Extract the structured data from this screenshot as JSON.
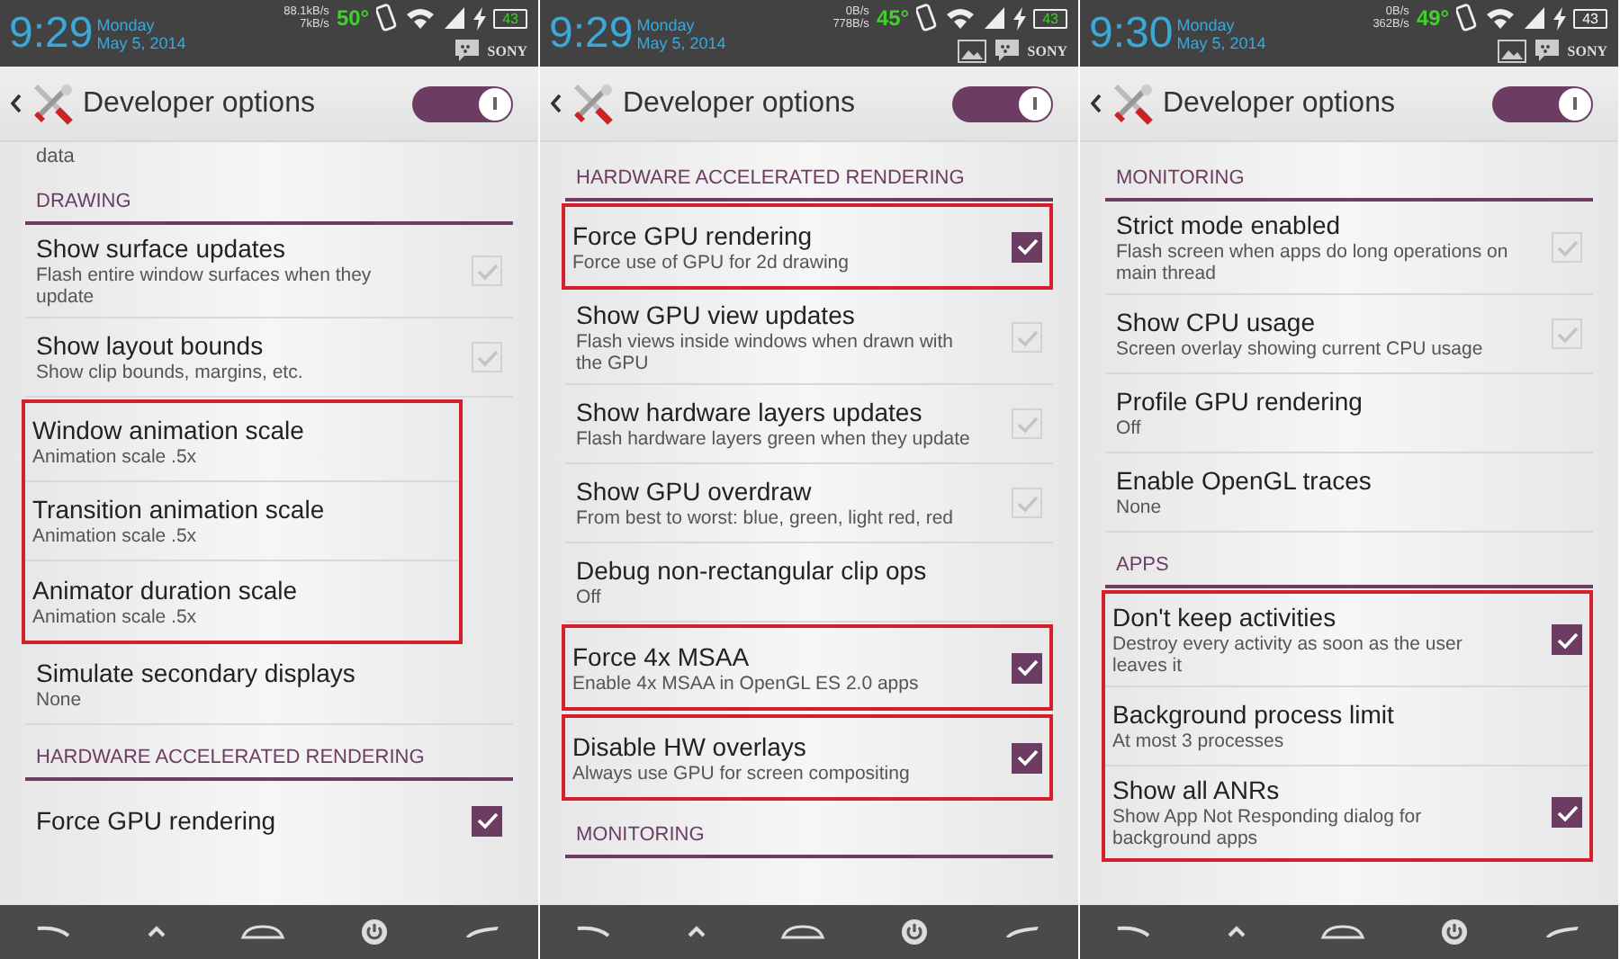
{
  "panels": [
    {
      "status_bar": {
        "time": "9:29",
        "day": "Monday",
        "date": "May 5, 2014",
        "net_up": "88.1kB/s",
        "net_down": "7kB/s",
        "temperature": "50°",
        "battery": "43",
        "battery_green": true,
        "image_notification": false,
        "brand": "SONY"
      },
      "header": {
        "title": "Developer options",
        "switch_on": true
      },
      "items": [
        {
          "kind": "fragment",
          "text": "data"
        },
        {
          "kind": "header",
          "label": "DRAWING"
        },
        {
          "kind": "option",
          "title": "Show surface updates",
          "summary": "Flash entire window surfaces when they update",
          "checked": false
        },
        {
          "kind": "option",
          "title": "Show layout bounds",
          "summary": "Show clip bounds, margins, etc.",
          "checked": false
        },
        {
          "kind": "highlight",
          "narrow": true,
          "items": [
            {
              "kind": "option",
              "title": "Window animation scale",
              "summary": "Animation scale .5x"
            },
            {
              "kind": "option",
              "title": "Transition animation scale",
              "summary": "Animation scale .5x"
            },
            {
              "kind": "option",
              "title": "Animator duration scale",
              "summary": "Animation scale .5x"
            }
          ]
        },
        {
          "kind": "option",
          "title": "Simulate secondary displays",
          "summary": "None"
        },
        {
          "kind": "header",
          "label": "HARDWARE ACCELERATED RENDERING"
        },
        {
          "kind": "option",
          "title": "Force GPU rendering",
          "checked": true
        }
      ]
    },
    {
      "status_bar": {
        "time": "9:29",
        "day": "Monday",
        "date": "May 5, 2014",
        "net_up": "0B/s",
        "net_down": "778B/s",
        "temperature": "45°",
        "battery": "43",
        "battery_green": true,
        "image_notification": true,
        "brand": "SONY"
      },
      "header": {
        "title": "Developer options",
        "switch_on": true
      },
      "items": [
        {
          "kind": "header",
          "label": "HARDWARE ACCELERATED RENDERING"
        },
        {
          "kind": "highlight",
          "narrow": false,
          "items": [
            {
              "kind": "option",
              "title": "Force GPU rendering",
              "summary": "Force use of GPU for 2d drawing",
              "checked": true
            }
          ]
        },
        {
          "kind": "option",
          "title": "Show GPU view updates",
          "summary": "Flash views inside windows when drawn with the GPU",
          "checked": false
        },
        {
          "kind": "option",
          "title": "Show hardware layers updates",
          "summary": "Flash hardware layers green when they update",
          "checked": false
        },
        {
          "kind": "option",
          "title": "Show GPU overdraw",
          "summary": "From best to worst: blue, green, light red, red",
          "checked": false
        },
        {
          "kind": "option",
          "title": "Debug non-rectangular clip ops",
          "summary": "Off"
        },
        {
          "kind": "highlight",
          "narrow": false,
          "items": [
            {
              "kind": "option",
              "title": "Force 4x MSAA",
              "summary": "Enable 4x MSAA in OpenGL ES 2.0 apps",
              "checked": true
            }
          ]
        },
        {
          "kind": "highlight",
          "narrow": false,
          "items": [
            {
              "kind": "option",
              "title": "Disable HW overlays",
              "summary": "Always use GPU for screen compositing",
              "checked": true
            }
          ]
        },
        {
          "kind": "header",
          "label": "MONITORING"
        }
      ]
    },
    {
      "status_bar": {
        "time": "9:30",
        "day": "Monday",
        "date": "May 5, 2014",
        "net_up": "0B/s",
        "net_down": "362B/s",
        "temperature": "49°",
        "battery": "43",
        "battery_green": false,
        "image_notification": true,
        "brand": "SONY"
      },
      "header": {
        "title": "Developer options",
        "switch_on": true
      },
      "items": [
        {
          "kind": "header",
          "label": "MONITORING"
        },
        {
          "kind": "option",
          "title": "Strict mode enabled",
          "summary": "Flash screen when apps do long operations on main thread",
          "checked": false
        },
        {
          "kind": "option",
          "title": "Show CPU usage",
          "summary": "Screen overlay showing current CPU usage",
          "checked": false
        },
        {
          "kind": "option",
          "title": "Profile GPU rendering",
          "summary": "Off"
        },
        {
          "kind": "option",
          "title": "Enable OpenGL traces",
          "summary": "None"
        },
        {
          "kind": "header",
          "label": "APPS"
        },
        {
          "kind": "highlight",
          "narrow": false,
          "items": [
            {
              "kind": "option",
              "title": "Don't keep activities",
              "summary": "Destroy every activity as soon as the user leaves it",
              "checked": true
            },
            {
              "kind": "option",
              "title": "Background process limit",
              "summary": "At most 3 processes"
            },
            {
              "kind": "option",
              "title": "Show all ANRs",
              "summary": "Show App Not Responding dialog for background apps",
              "checked": true
            }
          ]
        }
      ]
    }
  ]
}
